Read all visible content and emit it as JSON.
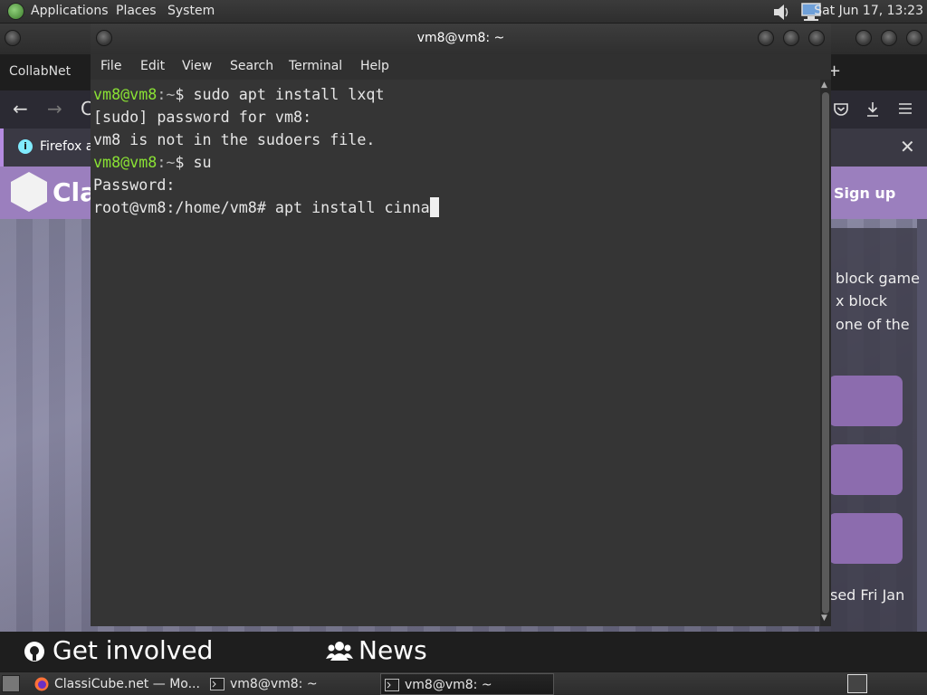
{
  "top_panel": {
    "menus": [
      "Applications",
      "Places",
      "System"
    ],
    "clock": "Sat Jun 17, 13:23"
  },
  "browser": {
    "tab_label": "CollabNet",
    "notification_text": "Firefox a",
    "site_logo_text": "Cla",
    "signup_label": "Sign up",
    "card_lines": [
      "block game",
      "x block",
      "one of the"
    ],
    "card_footer_text": "sed Fri Jan",
    "footer": {
      "get_involved": "Get involved",
      "news": "News"
    }
  },
  "terminal": {
    "title": "vm8@vm8: ~",
    "menu": [
      "File",
      "Edit",
      "View",
      "Search",
      "Terminal",
      "Help"
    ],
    "lines": [
      {
        "user": "vm8@vm8",
        "path": ":~",
        "text": "$ sudo apt install lxqt"
      },
      {
        "text": "[sudo] password for vm8:"
      },
      {
        "text": "vm8 is not in the sudoers file."
      },
      {
        "user": "vm8@vm8",
        "path": ":~",
        "text": "$ su"
      },
      {
        "text": "Password:"
      },
      {
        "text": "root@vm8:/home/vm8# apt install cinna"
      }
    ]
  },
  "taskbar": {
    "tasks": [
      {
        "label": "ClassiCube.net — Mo..."
      },
      {
        "label": "vm8@vm8: ~"
      },
      {
        "label": "vm8@vm8: ~"
      }
    ]
  }
}
